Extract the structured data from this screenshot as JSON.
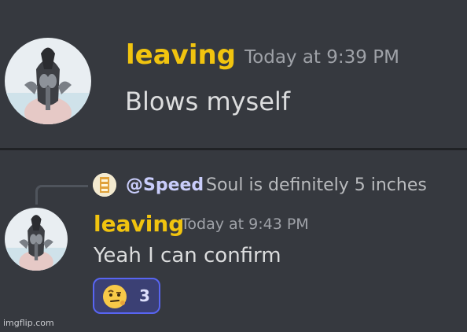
{
  "messages": [
    {
      "username": "leaving",
      "timestamp": "Today at 9:39 PM",
      "content": "Blows myself",
      "avatar_icon": "user-avatar-icon"
    },
    {
      "reply": {
        "mention": "@Speed",
        "text": "Soul is definitely 5 inches",
        "avatar_icon": "reply-user-avatar-icon"
      },
      "username": "leaving",
      "timestamp": "Today at 9:43 PM",
      "content": "Yeah I can confirm",
      "avatar_icon": "user-avatar-icon",
      "reaction": {
        "emoji_icon": "raised-eyebrow-emoji-icon",
        "count": "3"
      }
    }
  ],
  "watermark": "imgflip.com",
  "colors": {
    "background": "#36393f",
    "username": "#f1c40f",
    "timestamp": "#9fa2a8",
    "text": "#dcddde",
    "reaction_border": "#5865f2",
    "reaction_bg": "#3b4074",
    "divider": "#202225"
  }
}
